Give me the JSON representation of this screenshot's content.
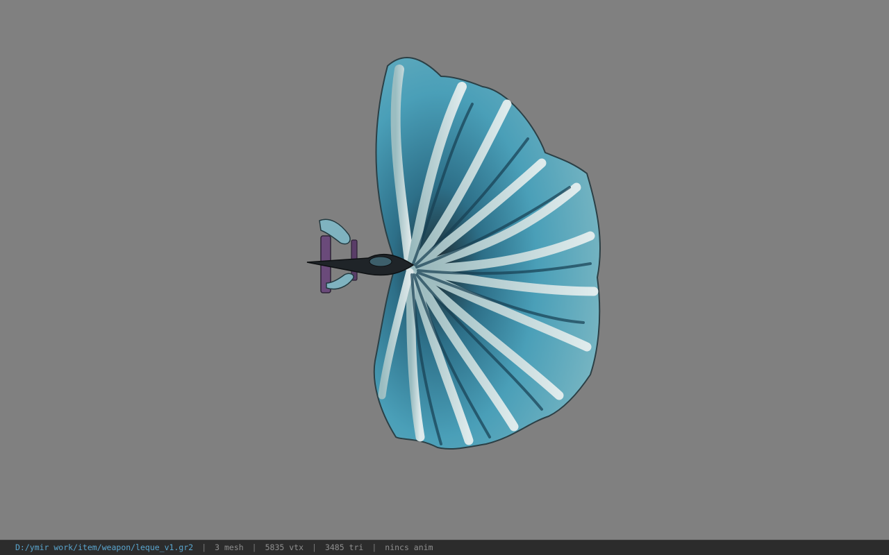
{
  "viewport": {
    "background": "#808080",
    "model_name": "leque fan weapon model"
  },
  "statusbar": {
    "file_path": "D:/ymir work/item/weapon/leque_v1.gr2",
    "separator": "|",
    "mesh_count": "3 mesh",
    "vertex_count": "5835 vtx",
    "triangle_count": "3485 tri",
    "anim_status": "nincs anim",
    "path_color": "#5aa6cf",
    "text_color": "#8f8f8f"
  }
}
